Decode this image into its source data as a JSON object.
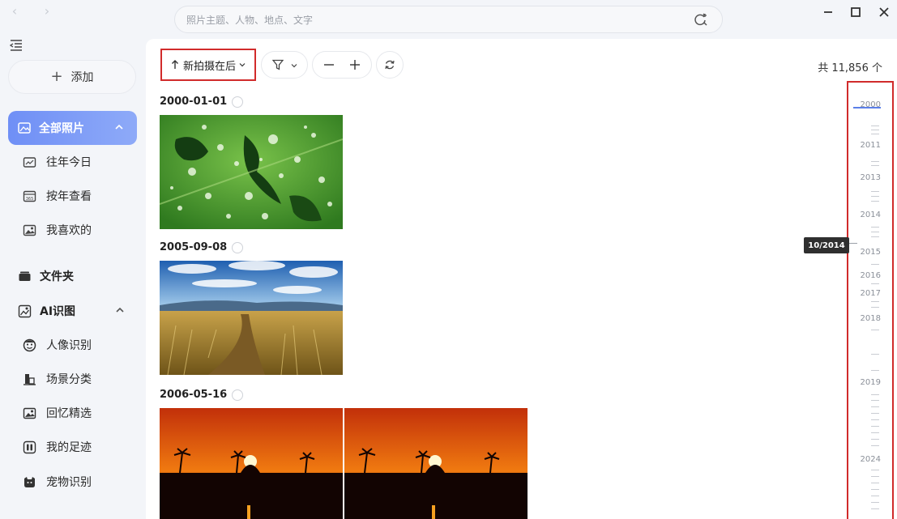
{
  "search": {
    "placeholder": "照片主题、人物、地点、文字"
  },
  "sidebar": {
    "add_label": "添加",
    "all_photos": "全部照片",
    "items": [
      {
        "label": "往年今日",
        "icon": "memories-icon"
      },
      {
        "label": "按年查看",
        "icon": "calendar-icon"
      },
      {
        "label": "我喜欢的",
        "icon": "favorites-icon"
      }
    ],
    "folder": "文件夹",
    "ai_section": "AI识图",
    "ai_items": [
      {
        "label": "人像识别",
        "icon": "face-icon"
      },
      {
        "label": "场景分类",
        "icon": "scene-icon"
      },
      {
        "label": "回忆精选",
        "icon": "gallery-icon"
      },
      {
        "label": "我的足迹",
        "icon": "map-icon"
      },
      {
        "label": "宠物识别",
        "icon": "pet-icon"
      }
    ]
  },
  "toolbar": {
    "sort_label": "新拍摄在后",
    "count_label": "共 11,856 个"
  },
  "groups": [
    {
      "date": "2000-01-01"
    },
    {
      "date": "2005-09-08"
    },
    {
      "date": "2006-05-16"
    }
  ],
  "timeline": {
    "years": [
      "2000",
      "2011",
      "2013",
      "2014",
      "2015",
      "2016",
      "2017",
      "2018",
      "2019",
      "2024"
    ],
    "tooltip": "10/2014"
  },
  "colors": {
    "accent": "#7393f6",
    "highlight_border": "#d12b2b"
  }
}
